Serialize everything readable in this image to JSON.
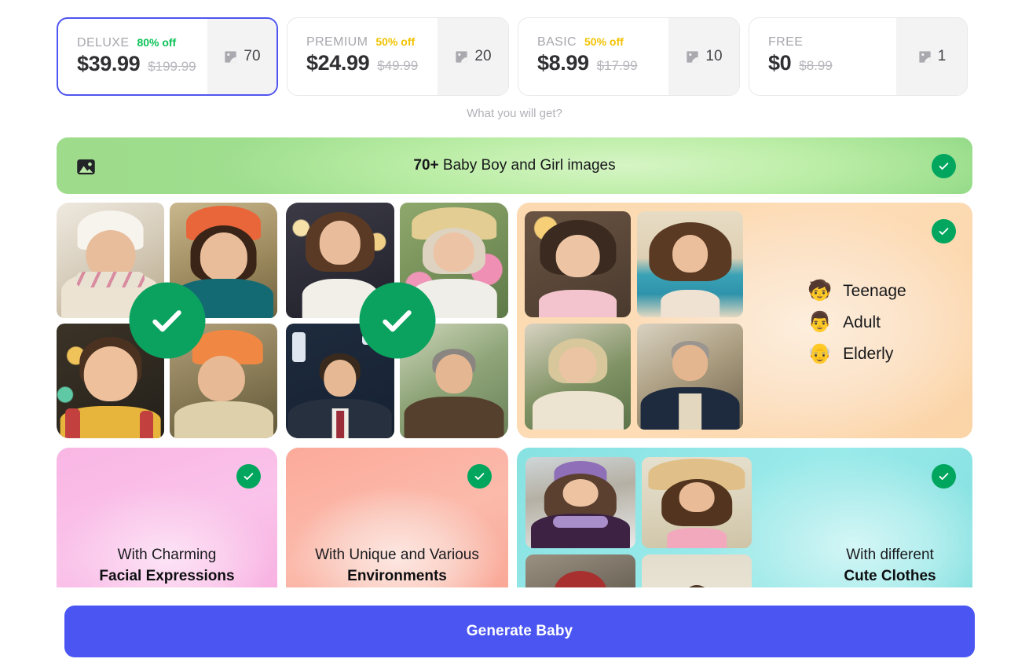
{
  "plans": [
    {
      "name": "DELUXE",
      "discount": "80% off",
      "discount_style": "green",
      "price": "$39.99",
      "old_price": "$199.99",
      "credits": "70",
      "selected": true
    },
    {
      "name": "PREMIUM",
      "discount": "50% off",
      "discount_style": "yellow",
      "price": "$24.99",
      "old_price": "$49.99",
      "credits": "20",
      "selected": false
    },
    {
      "name": "BASIC",
      "discount": "50% off",
      "discount_style": "yellow",
      "price": "$8.99",
      "old_price": "$17.99",
      "credits": "10",
      "selected": false
    },
    {
      "name": "FREE",
      "discount": "",
      "discount_style": "none",
      "price": "$0",
      "old_price": "$8.99",
      "credits": "1",
      "selected": false
    }
  ],
  "subtitle": "What you will get?",
  "banner": {
    "count": "70+",
    "text": " Baby Boy and Girl images",
    "icon": "image-icon",
    "check_icon": "check-circle-icon"
  },
  "features": {
    "kids_panel": {
      "check_icon": "check-circle-large-icon"
    },
    "adults_panel": {
      "check_icon": "check-circle-large-icon"
    },
    "ages_panel": {
      "check_icon": "check-circle-icon",
      "items": [
        {
          "emoji": "🧒",
          "label": "Teenage"
        },
        {
          "emoji": "👨",
          "label": "Adult"
        },
        {
          "emoji": "👴",
          "label": "Elderly"
        }
      ]
    },
    "cards": [
      {
        "caption_top": "With Charming",
        "caption_bottom": "Facial Expressions",
        "check_icon": "check-circle-icon"
      },
      {
        "caption_top": "With Unique and Various",
        "caption_bottom": "Environments",
        "check_icon": "check-circle-icon"
      },
      {
        "caption_top": "With different",
        "caption_bottom": "Cute Clothes",
        "check_icon": "check-circle-icon"
      }
    ]
  },
  "cta": {
    "label": "Generate Baby"
  },
  "colors": {
    "accent": "#4a55f2",
    "check_green": "#00a65e",
    "discount_green": "#0bc256",
    "discount_yellow": "#f2c201",
    "banner_green": "#9edc8c",
    "ages_orange": "#fcd9b0",
    "card_pink": "#f9b6e4",
    "card_salmon": "#fcaa9a",
    "card_cyan": "#88e2e2"
  }
}
